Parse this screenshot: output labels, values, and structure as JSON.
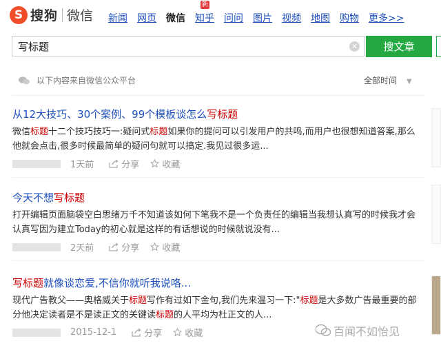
{
  "logo": {
    "glyph": "S",
    "name": "搜狗",
    "sub": "微信"
  },
  "nav": [
    {
      "label": "新闻",
      "active": false
    },
    {
      "label": "网页",
      "active": false
    },
    {
      "label": "微信",
      "active": true
    },
    {
      "label": "知乎",
      "active": false,
      "badge": "新"
    },
    {
      "label": "问问",
      "active": false
    },
    {
      "label": "图片",
      "active": false
    },
    {
      "label": "视频",
      "active": false
    },
    {
      "label": "地图",
      "active": false
    },
    {
      "label": "购物",
      "active": false
    },
    {
      "label": "更多>>",
      "active": false
    }
  ],
  "search": {
    "value": "写标题",
    "button": "搜文章",
    "button2": "搜"
  },
  "source_note": "以下内容来自微信公众平台",
  "time_filter": "全部时间",
  "results": [
    {
      "title": [
        {
          "t": "从12大技巧、30个案例、99个模板谈怎么"
        },
        {
          "t": "写标题",
          "hl": true
        }
      ],
      "desc": [
        {
          "t": "微信"
        },
        {
          "t": "标题",
          "hl": true
        },
        {
          "t": "十二个技巧技巧一:疑问式"
        },
        {
          "t": "标题",
          "hl": true
        },
        {
          "t": "如果你的提问可以引发用户的共鸣,而用户也很想知道答案,那么他就会点击,很多时候最简单的疑问句就可以搞定.我见过很多运..."
        }
      ],
      "date": "1天前",
      "share": "分享",
      "fav": "收藏"
    },
    {
      "title": [
        {
          "t": "今天不想"
        },
        {
          "t": "写标题",
          "hl": true
        }
      ],
      "desc": [
        {
          "t": "打开编辑页面脑袋空白思绪万千不知道该如何下笔我不是一个负责任的编辑当我想认真写的时候我才会认真写因为建立Today的初心就是这样的有话想说的时候就说没有..."
        }
      ],
      "date": "2天前",
      "share": "分享",
      "fav": "收藏"
    },
    {
      "title": [
        {
          "t": "写标题",
          "hl": true
        },
        {
          "t": "就像谈恋爱,不信你就听我说咯..."
        }
      ],
      "desc": [
        {
          "t": "现代广告教父——奥格威关于"
        },
        {
          "t": "标题",
          "hl": true
        },
        {
          "t": "写作有过如下金句,我们先来温习一下:\""
        },
        {
          "t": "标题",
          "hl": true
        },
        {
          "t": "是大多数广告最重要的部分他决定读者是不是读正文的关键读"
        },
        {
          "t": "标题",
          "hl": true
        },
        {
          "t": "的人平均为杜正文的人..."
        }
      ],
      "date": "2015-12-1",
      "share": "分享",
      "fav": "收藏"
    }
  ],
  "watermark": "百闻不如怡见"
}
